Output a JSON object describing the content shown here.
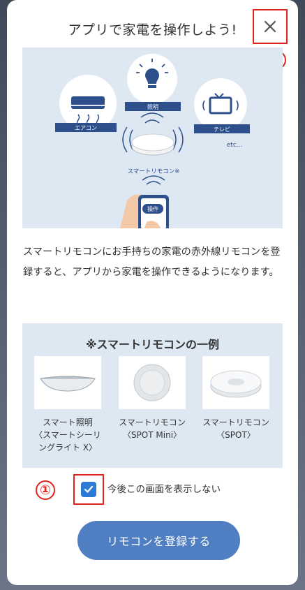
{
  "dialog": {
    "title": "アプリで家電を操作しよう!",
    "close_label": "×",
    "description": "スマートリモコンにお手持ちの家電の赤外線リモコンを登録すると、アプリから家電を操作できるようになります。"
  },
  "annotations": {
    "one": "①",
    "two": "②"
  },
  "illustration": {
    "labels": {
      "aircon": "エアコン",
      "light": "照明",
      "tv": "テレビ",
      "etc": "etc...",
      "remote": "スマートリモコン※",
      "operate": "操作"
    }
  },
  "examples": {
    "title": "※スマートリモコンの一例",
    "items": [
      {
        "name_line1": "スマート照明",
        "name_line2": "〈スマートシーリ",
        "name_line3": "ングライト X〉"
      },
      {
        "name_line1": "スマートリモコン",
        "name_line2": "〈SPOT Mini〉",
        "name_line3": ""
      },
      {
        "name_line1": "スマートリモコン",
        "name_line2": "〈SPOT〉",
        "name_line3": ""
      }
    ]
  },
  "checkbox": {
    "label": "今後この画面を表示しない",
    "checked": true
  },
  "primary_button": {
    "label": "リモコンを登録する"
  },
  "colors": {
    "accent": "#4f7fc2",
    "annotation": "#e0231d",
    "panel": "#dde8f3",
    "checkbox": "#2e7bd6"
  }
}
